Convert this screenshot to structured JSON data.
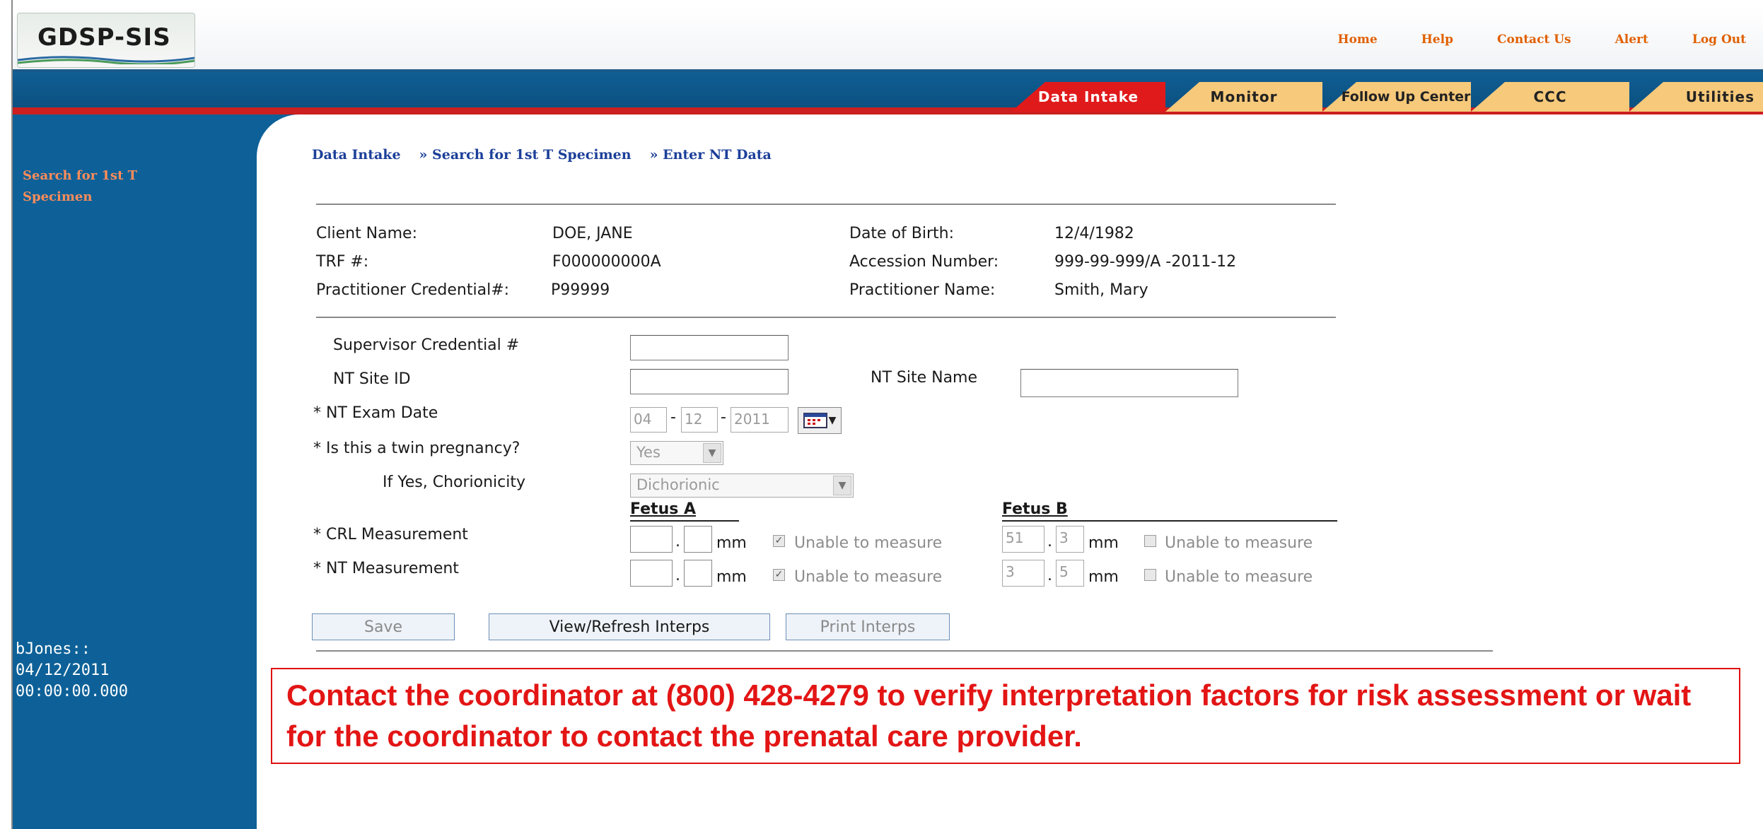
{
  "app": {
    "logo_text": "GDSP-SIS"
  },
  "top_links": [
    "Home",
    "Help",
    "Contact Us",
    "Alert",
    "Log Out"
  ],
  "tabs": [
    {
      "label": "Data Intake",
      "color": "#e01a1a",
      "text_color": "#ffffff"
    },
    {
      "label": "Monitor",
      "color": "#f7c97a"
    },
    {
      "label": "Follow Up Center",
      "color": "#f7c97a"
    },
    {
      "label": "CCC",
      "color": "#f7c97a"
    },
    {
      "label": "Utilities",
      "color": "#f7c97a"
    }
  ],
  "sidebar": {
    "link": "Search for 1st T Specimen",
    "user_line1": "bJones::",
    "user_line2": "04/12/2011",
    "user_line3": "00:00:00.000"
  },
  "breadcrumb": [
    "Data Intake",
    "» Search for 1st T Specimen",
    "» Enter NT Data"
  ],
  "client": {
    "client_name_label": "Client Name:",
    "client_name": "DOE, JANE",
    "trf_label": "TRF #:",
    "trf": "F000000000A",
    "credential_label": "Practitioner Credential#:",
    "credential": "P99999",
    "dob_label": "Date of Birth:",
    "dob": "12/4/1982",
    "accession_label": "Accession Number:",
    "accession": "999-99-999/A -2011-12",
    "practitioner_label": "Practitioner Name:",
    "practitioner": "Smith, Mary"
  },
  "form": {
    "supervisor_label": "Supervisor Credential #",
    "site_id_label": "NT Site ID",
    "site_name_label": "NT Site Name",
    "exam_date_label": "* NT Exam Date",
    "exam_month": "04",
    "exam_day": "12",
    "exam_year": "2011",
    "twin_label": "* Is this a twin pregnancy?",
    "twin_value": "Yes",
    "chorionicity_label": "If Yes, Chorionicity",
    "chorionicity_value": "Dichorionic",
    "fetus_a": "Fetus A",
    "fetus_b": "Fetus B",
    "crl_label": "* CRL Measurement",
    "nt_label": "* NT Measurement",
    "unit": "mm",
    "unable_label": "Unable to measure",
    "crl_b_int": "51",
    "crl_b_dec": "3",
    "nt_b_int": "3",
    "nt_b_dec": "5",
    "dot": "."
  },
  "buttons": {
    "save": "Save",
    "view_refresh": "View/Refresh Interps",
    "print": "Print Interps"
  },
  "alert": {
    "message": "Contact the coordinator at (800) 428-4279 to verify interpretation factors for risk assessment or wait for the coordinator to contact the prenatal care provider."
  }
}
